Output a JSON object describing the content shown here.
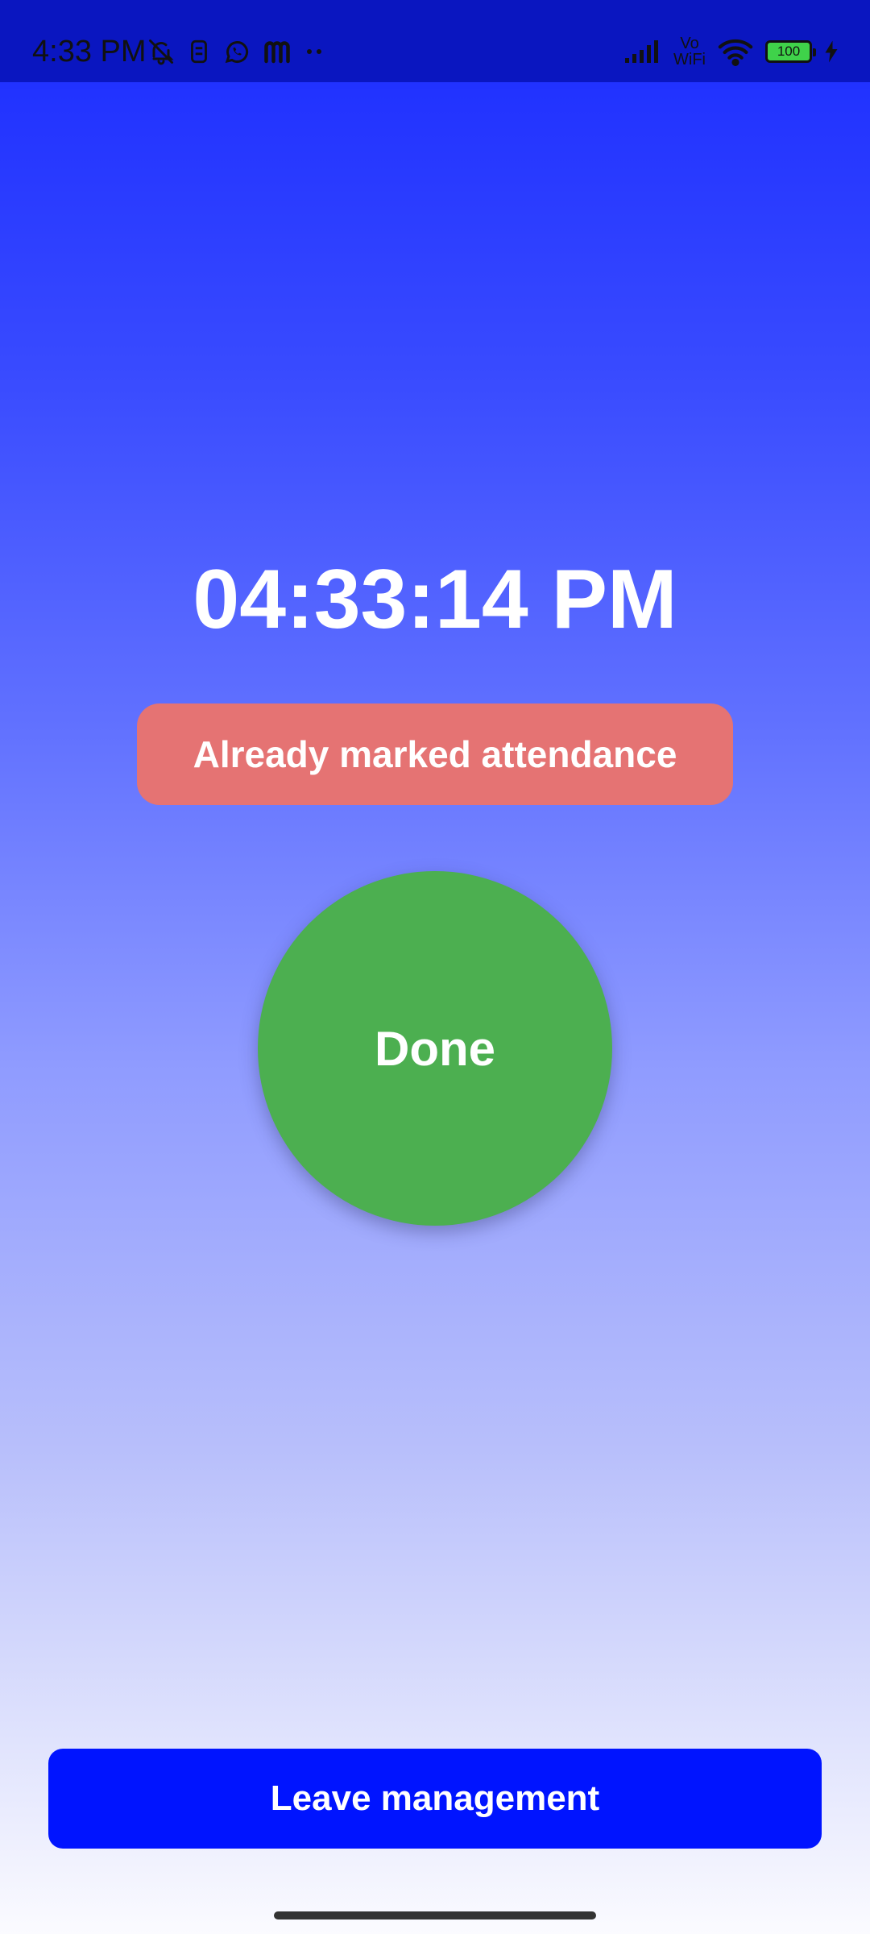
{
  "status_bar": {
    "time": "4:33 PM",
    "left_icons": [
      "mute-bell-icon",
      "sim-icon",
      "whatsapp-icon",
      "m-app-icon",
      "more-dots-icon"
    ],
    "right_icons": [
      "signal-icon",
      "vowifi-icon",
      "wifi-icon",
      "battery-icon",
      "charging-icon"
    ],
    "vowifi_top": "Vo",
    "vowifi_bottom": "WiFi",
    "battery_level": "100"
  },
  "main": {
    "clock": "04:33:14 PM",
    "alert_message": "Already marked attendance",
    "done_label": "Done"
  },
  "footer": {
    "leave_button_label": "Leave management"
  },
  "colors": {
    "status_bar_bg": "#0a16c0",
    "alert_bg": "#e57373",
    "done_bg": "#4caf50",
    "leave_button_bg": "#0014ff"
  }
}
